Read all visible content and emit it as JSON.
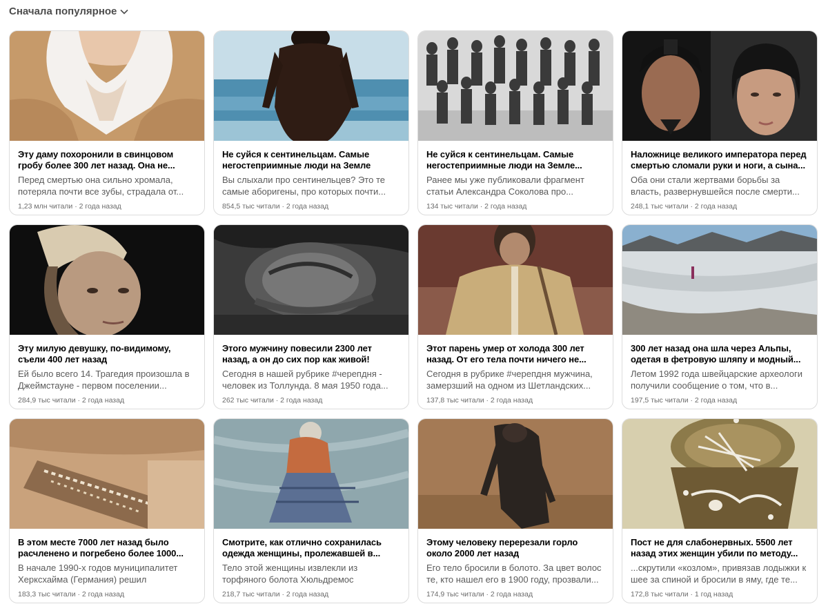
{
  "sort_label": "Сначала популярное",
  "articles": [
    {
      "title": "Эту даму похоронили в свинцовом гробу более 300 лет назад. Она не...",
      "snippet": "Перед смертью она сильно хромала, потеряла почти все зубы, страдала от...",
      "views": "1,23 млн читали",
      "age": "2 года назад"
    },
    {
      "title": "Не суйся к сентинельцам. Самые негостеприимные люди на Земле",
      "snippet": "Вы слыхали про сентинельцев? Это те самые аборигены, про которых почти...",
      "views": "854,5 тыс читали",
      "age": "2 года назад"
    },
    {
      "title": "Не суйся к сентинельцам. Самые негостеприимные люди на Земле...",
      "snippet": "Ранее мы уже публиковали фрагмент статьи Александра Соколова про...",
      "views": "134 тыс читали",
      "age": "2 года назад"
    },
    {
      "title": "Наложнице великого императора перед смертью сломали руки и ноги, а сына...",
      "snippet": "Оба они стали жертвами борьбы за власть, развернувшейся после смерти...",
      "views": "248,1 тыс читали",
      "age": "2 года назад"
    },
    {
      "title": "Эту милую девушку, по-видимому, съели 400 лет назад",
      "snippet": "Ей было всего 14. Трагедия произошла в Джеймстауне - первом поселении...",
      "views": "284,9 тыс читали",
      "age": "2 года назад"
    },
    {
      "title": "Этого мужчину повесили 2300 лет назад, а он до сих пор как живой!",
      "snippet": "Сегодня в нашей рубрике #черепдня - человек из Толлунда. 8 мая 1950 года...",
      "views": "262 тыс читали",
      "age": "2 года назад"
    },
    {
      "title": "Этот парень умер от холода 300 лет назад. От его тела почти ничего не...",
      "snippet": "Сегодня в рубрике #черепдня мужчина, замерзший на одном из Шетландских...",
      "views": "137,8 тыс читали",
      "age": "2 года назад"
    },
    {
      "title": "300 лет назад она шла через Альпы, одетая в фетровую шляпу и модный...",
      "snippet": "Летом 1992 года швейцарские археологи получили сообщение о том, что в...",
      "views": "197,5 тыс читали",
      "age": "2 года назад"
    },
    {
      "title": "В этом месте 7000 лет назад было расчленено и погребено более 1000...",
      "snippet": "В начале 1990-х годов муниципалитет Херксхайма (Германия) решил построить...",
      "views": "183,3 тыс читали",
      "age": "2 года назад"
    },
    {
      "title": "Смотрите, как отлично сохранилась одежда женщины, пролежавшей в...",
      "snippet": "Тело этой женщины извлекли из торфяного болота Хюльдремос недалеко...",
      "views": "218,7 тыс читали",
      "age": "2 года назад"
    },
    {
      "title": "Этому человеку перерезали горло около 2000 лет назад",
      "snippet": "Его тело бросили в болото. За цвет волос те, кто нашел его в 1900 году, прозвали...",
      "views": "174,9 тыс читали",
      "age": "2 года назад"
    },
    {
      "title": "Пост не для слабонервных. 5500 лет назад этих женщин убили по методу...",
      "snippet": "...скрутили «козлом», привязав лодыжки к шее за спиной и бросили в яму, где те...",
      "views": "172,8 тыс читали",
      "age": "1 год назад"
    }
  ]
}
